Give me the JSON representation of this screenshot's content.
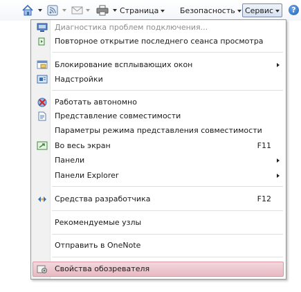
{
  "toolbar": {
    "page_label": "Страница",
    "security_label": "Безопасность",
    "tools_label": "Сервис",
    "help_glyph": "?"
  },
  "menu": {
    "items": [
      {
        "label": "Диагностика проблем подключения...",
        "icon": "network-diagnostics-icon",
        "disabled": true
      },
      {
        "label": "Повторное открытие последнего сеанса просмотра",
        "icon": "reopen-session-icon"
      },
      {
        "label": "Блокирование всплывающих окон",
        "icon": "popup-blocker-icon",
        "submenu": true
      },
      {
        "label": "Надстройки",
        "icon": "addons-icon"
      },
      {
        "label": "Работать автономно",
        "icon": "work-offline-icon"
      },
      {
        "label": "Представление совместимости",
        "icon": "compatibility-view-icon"
      },
      {
        "label": "Параметры режима представления совместимости"
      },
      {
        "label": "Во весь экран",
        "icon": "fullscreen-icon",
        "shortcut": "F11"
      },
      {
        "label": "Панели",
        "submenu": true
      },
      {
        "label": "Панели Explorer",
        "submenu": true
      },
      {
        "label": "Средства разработчика",
        "icon": "developer-tools-icon",
        "shortcut": "F12"
      },
      {
        "label": "Рекомендуемые узлы"
      },
      {
        "label": "Отправить в OneNote"
      },
      {
        "label": "Свойства обозревателя",
        "icon": "internet-options-icon",
        "highlighted": true
      }
    ]
  },
  "colors": {
    "highlight": "#e8b9c3",
    "disabled_text": "#8d8d8d",
    "accent": "#1d5fb6"
  }
}
